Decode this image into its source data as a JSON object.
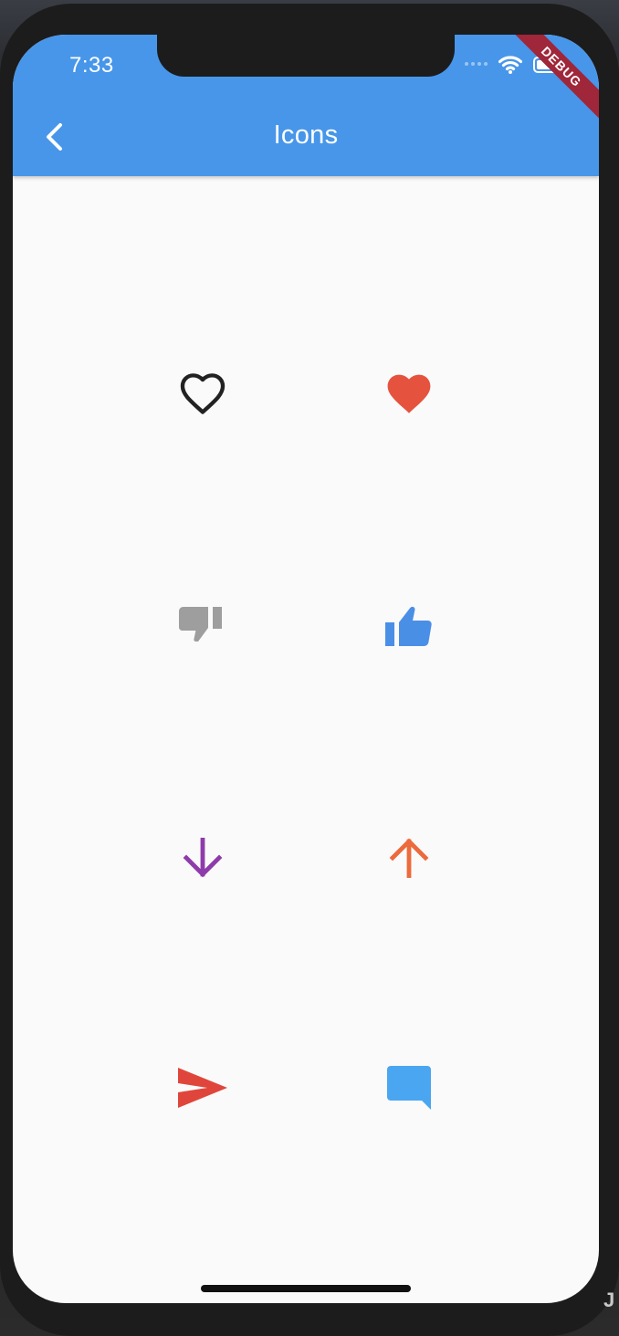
{
  "status_bar": {
    "time": "7:33",
    "debug_label": "DEBUG"
  },
  "app_bar": {
    "title": "Icons",
    "color": "#4796e9"
  },
  "icons": [
    {
      "name": "heart-outline-icon",
      "color": "#222222"
    },
    {
      "name": "heart-filled-icon",
      "color": "#e5533f"
    },
    {
      "name": "thumb-down-icon",
      "color": "#9e9e9e"
    },
    {
      "name": "thumb-up-icon",
      "color": "#4a8fe6"
    },
    {
      "name": "arrow-down-icon",
      "color": "#8e3bab"
    },
    {
      "name": "arrow-up-icon",
      "color": "#ec6a3b"
    },
    {
      "name": "send-icon",
      "color": "#e0453b"
    },
    {
      "name": "chat-bubble-icon",
      "color": "#4aa6f0"
    }
  ],
  "corner_text": "J"
}
